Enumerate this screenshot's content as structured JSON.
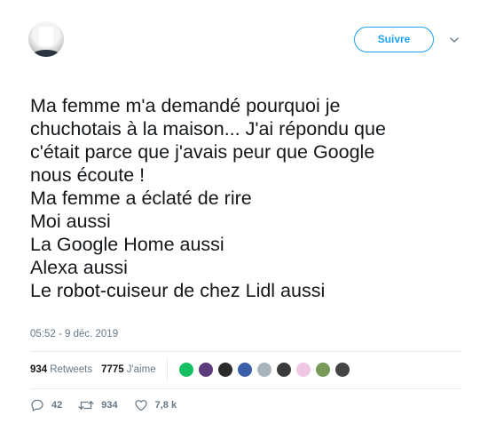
{
  "header": {
    "follow_label": "Suivre"
  },
  "tweet": {
    "lines": [
      "Ma femme m'a demandé pourquoi je",
      "chuchotais à la maison... J'ai répondu que",
      "c'était parce que j'avais peur que Google",
      "nous écoute !",
      "Ma femme a éclaté de rire",
      "Moi aussi",
      "La Google Home aussi",
      "Alexa aussi",
      "Le robot-cuiseur de chez Lidl aussi"
    ],
    "timestamp": "05:52 - 9 déc. 2019"
  },
  "stats": {
    "retweets_count": "934",
    "retweets_label": "Retweets",
    "likes_count": "7775",
    "likes_label": "J'aime",
    "liker_avatar_colors": [
      "#17bf63",
      "#5b3b7a",
      "#2b2b2b",
      "#3a5fa8",
      "#aab4be",
      "#3b3b3b",
      "#f0c6e4",
      "#7a9a5a",
      "#444444"
    ]
  },
  "actions": {
    "reply_count": "42",
    "retweet_count": "934",
    "like_count": "7,8 k"
  },
  "colors": {
    "accent": "#1da1f2",
    "text": "#14171a",
    "muted": "#657786",
    "divider": "#e6ecf0"
  },
  "icons": {
    "caret": "chevron-down-icon",
    "reply": "reply-icon",
    "retweet": "retweet-icon",
    "like": "heart-icon"
  }
}
